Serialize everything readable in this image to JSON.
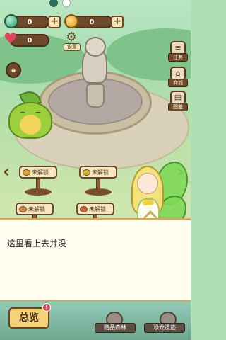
{
  "hud": {
    "gems": "0",
    "coins": "0",
    "hearts": "0",
    "settings_label": "设置"
  },
  "side_menu": [
    {
      "label": "任务",
      "icon": "task-scroll-icon"
    },
    {
      "label": "商城",
      "icon": "shop-icon"
    },
    {
      "label": "图鉴",
      "icon": "book-icon"
    }
  ],
  "plots": [
    {
      "label": "未解锁",
      "seed_color": "#d9a232"
    },
    {
      "label": "未解锁",
      "seed_color": "#d3b23a"
    },
    {
      "label": "未解锁",
      "seed_color": "#c9894a"
    },
    {
      "label": "未解锁",
      "seed_color": "#c9663f"
    }
  ],
  "dialog": {
    "text": "这里看上去并没"
  },
  "bottom_bar": {
    "overview_label": "总览",
    "overview_badge": "!",
    "buttons": [
      {
        "label": "赠品森林",
        "icon": "mushroom-icon"
      },
      {
        "label": "恐龙遗迹",
        "icon": "dino-icon"
      }
    ]
  },
  "colors": {
    "wood": "#6f4a2a",
    "parchment": "#f6e7c0",
    "accent_red": "#e2435a"
  }
}
